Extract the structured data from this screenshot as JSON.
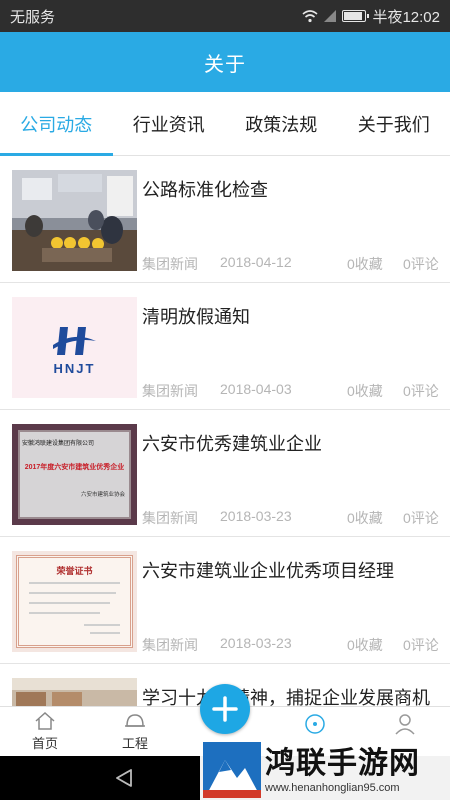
{
  "status_bar": {
    "carrier": "无服务",
    "time": "半夜12:02"
  },
  "header": {
    "title": "关于"
  },
  "tabs": [
    {
      "label": "公司动态",
      "active": true
    },
    {
      "label": "行业资讯",
      "active": false
    },
    {
      "label": "政策法规",
      "active": false
    },
    {
      "label": "关于我们",
      "active": false
    }
  ],
  "news": [
    {
      "title": "公路标准化检查",
      "source": "集团新闻",
      "date": "2018-04-12",
      "favorites": "0收藏",
      "comments": "0评论"
    },
    {
      "title": "清明放假通知",
      "source": "集团新闻",
      "date": "2018-04-03",
      "favorites": "0收藏",
      "comments": "0评论",
      "thumb_logo": "HNJT"
    },
    {
      "title": "六安市优秀建筑业企业",
      "source": "集团新闻",
      "date": "2018-03-23",
      "favorites": "0收藏",
      "comments": "0评论",
      "thumb_text": {
        "company": "安徽鸿联建设集团有限公司",
        "award": "2017年度六安市建筑业优秀企业",
        "issuer": "六安市建筑业协会"
      }
    },
    {
      "title": "六安市建筑业企业优秀项目经理",
      "source": "集团新闻",
      "date": "2018-03-23",
      "favorites": "0收藏",
      "comments": "0评论",
      "thumb_text": {
        "heading": "荣誉证书"
      }
    },
    {
      "title": "学习十九大精神，捕捉企业发展商机"
    }
  ],
  "bottom_nav": [
    {
      "label": "首页",
      "icon": "home-icon"
    },
    {
      "label": "工程",
      "icon": "helmet-icon"
    },
    {
      "label": "",
      "icon": "add-icon"
    },
    {
      "label": "",
      "icon": "compass-icon"
    },
    {
      "label": "",
      "icon": "user-icon"
    }
  ],
  "watermark": {
    "brand": "鸿联手游网",
    "url": "www.henanhonglian95.com"
  },
  "colors": {
    "accent": "#2aaae4",
    "meta_text": "#b5b5b5",
    "fab": "#1ea7e4"
  }
}
